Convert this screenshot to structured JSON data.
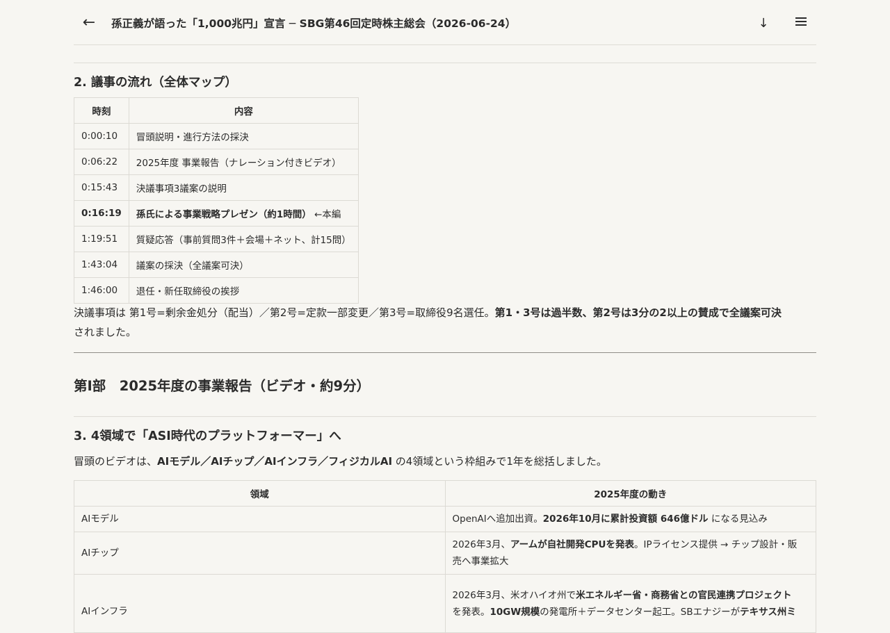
{
  "header": {
    "title": "孫正義が語った「1,000兆円」宣言 ─ SBG第46回定時株主総会（2026-06-24）",
    "back_icon": "←",
    "download_icon": "↓"
  },
  "section2": {
    "heading": "2. 議事の流れ（全体マップ）",
    "columns": [
      "時刻",
      "内容"
    ],
    "rows": [
      {
        "time": "0:00:10",
        "content": "冒頭説明・進行方法の採決",
        "suffix": ""
      },
      {
        "time": "0:06:22",
        "content": "2025年度 事業報告（ナレーション付きビデオ）",
        "suffix": ""
      },
      {
        "time": "0:15:43",
        "content": "決議事項3議案の説明",
        "suffix": ""
      },
      {
        "time": "0:16:19",
        "content": "孫氏による事業戦略プレゼン（約1時間）",
        "suffix": " ←本編"
      },
      {
        "time": "1:19:51",
        "content": "質疑応答（事前質問3件＋会場＋ネット、計15問）",
        "suffix": ""
      },
      {
        "time": "1:43:04",
        "content": "議案の採決（全議案可決）",
        "suffix": ""
      },
      {
        "time": "1:46:00",
        "content": "退任・新任取締役の挨拶",
        "suffix": ""
      }
    ],
    "note_plain": "決議事項は 第1号=剰余金処分（配当）／第2号=定款一部変更／第3号=取締役9名選任。",
    "note_bold": "第1・3号は過半数、第2号は3分の2以上の賛成で全議案可決",
    "note_tail": "されました。"
  },
  "part1": {
    "heading": "第Ⅰ部　2025年度の事業報告（ビデオ・約9分）"
  },
  "section3": {
    "heading": "3. 4領域で「ASI時代のプラットフォーマー」へ",
    "intro_pre": "冒頭のビデオは、",
    "intro_bold": "AIモデル／AIチップ／AIインフラ／フィジカルAI",
    "intro_post": " の4領域という枠組みで1年を総括しました。",
    "columns": [
      "領域",
      "2025年度の動き"
    ],
    "rows": [
      {
        "area": "AIモデル",
        "line1_pre": "OpenAIへ追加出資。",
        "line1_bold": "2026年10月に累計投資額 646億ドル",
        "line1_post": " になる見込み"
      },
      {
        "area": "AIチップ",
        "line1_pre": "2026年3月、",
        "line1_bold": "アームが自社開発CPUを発表",
        "line1_post": "。IPライセンス提供 → チップ設計・販",
        "line2": "売へ事業拡大"
      },
      {
        "area": "AIインフラ",
        "line1_pre": "2026年3月、米オハイオ州で",
        "line1_bold": "米エネルギー省・商務省との官民連携プロジェクト",
        "line1_post": "",
        "line2_pre": "を発表。",
        "line2_bold": "10GW規模",
        "line2_mid": "の発電所＋データセンター起工。SBエナジーが",
        "line2_bold2": "テキサス州ミ"
      }
    ]
  }
}
